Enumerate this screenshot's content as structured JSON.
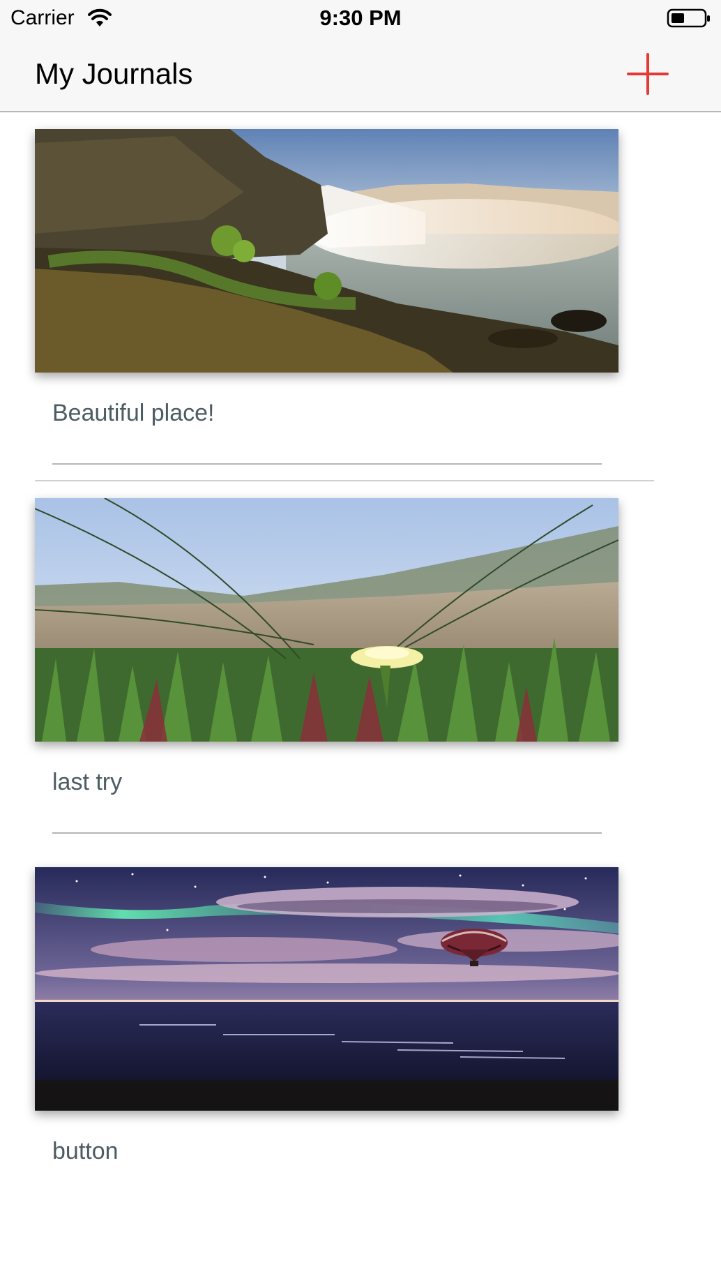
{
  "status_bar": {
    "carrier": "Carrier",
    "time": "9:30 PM",
    "icons": [
      "wifi-icon",
      "battery-icon"
    ]
  },
  "nav": {
    "title": "My Journals",
    "add_icon": "plus-icon",
    "accent_color": "#e53935"
  },
  "journals": [
    {
      "caption": "Beautiful place!",
      "image": "waterfall-landscape"
    },
    {
      "caption": "last try",
      "image": "flower-meadow"
    },
    {
      "caption": "button",
      "image": "aurora-balloon-night"
    }
  ]
}
